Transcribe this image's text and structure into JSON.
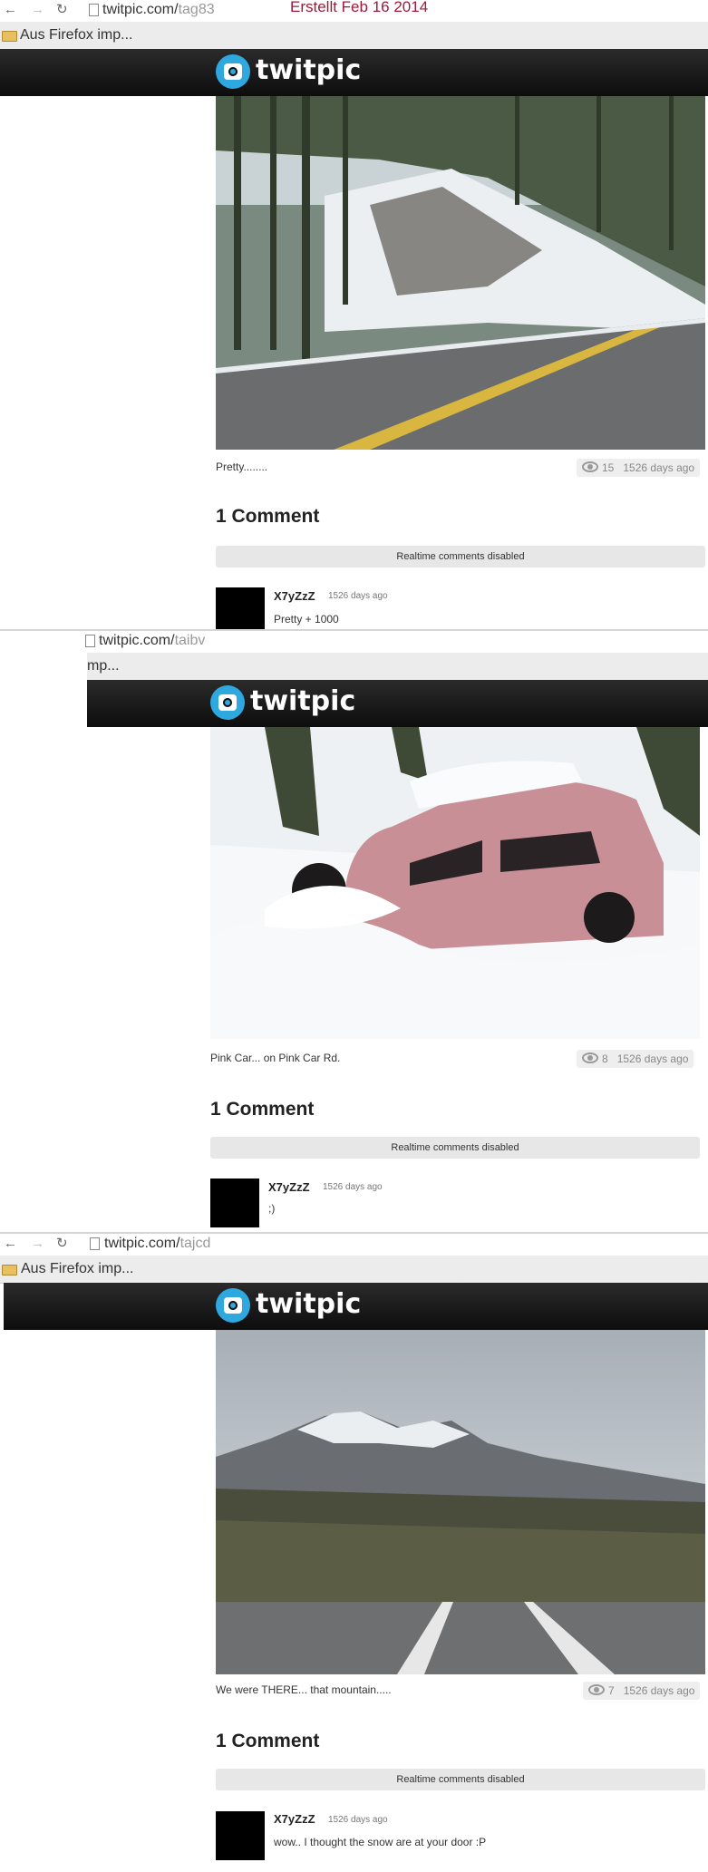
{
  "screens": [
    {
      "url_host": "twitpic.com/",
      "url_path": "tag83",
      "stamp": "Erstellt Feb 16 2014",
      "bookmark": "Aus Firefox imp...",
      "caption": "Pretty........",
      "views": "15",
      "age": "1526 days ago",
      "comments_title": "1 Comment",
      "realtime": "Realtime comments disabled",
      "comment": {
        "user": "X7yZzZ",
        "time": "1526 days ago",
        "text": "Pretty + 1000"
      }
    },
    {
      "url_host": "twitpic.com/",
      "url_path": "taibv",
      "bookmark": "mp...",
      "caption": "Pink Car... on Pink Car Rd.",
      "views": "8",
      "age": "1526 days ago",
      "comments_title": "1 Comment",
      "realtime": "Realtime comments disabled",
      "comment": {
        "user": "X7yZzZ",
        "time": "1526 days ago",
        "text": ";)"
      }
    },
    {
      "url_host": "twitpic.com/",
      "url_path": "tajcd",
      "bookmark": "Aus Firefox imp...",
      "caption": "We were THERE... that mountain.....",
      "views": "7",
      "age": "1526 days ago",
      "comments_title": "1 Comment",
      "realtime": "Realtime comments disabled",
      "comment": {
        "user": "X7yZzZ",
        "time": "1526 days ago",
        "text": "wow.. I thought the snow are at your door :P"
      }
    }
  ],
  "brand": {
    "logo_text": "twitpic",
    "accent": "#2fa8e0",
    "header_bg": "#111111"
  },
  "icons": {
    "back": "arrow-left-icon",
    "forward": "arrow-right-icon",
    "reload": "reload-icon",
    "folder": "folder-icon",
    "eye": "eye-icon"
  }
}
